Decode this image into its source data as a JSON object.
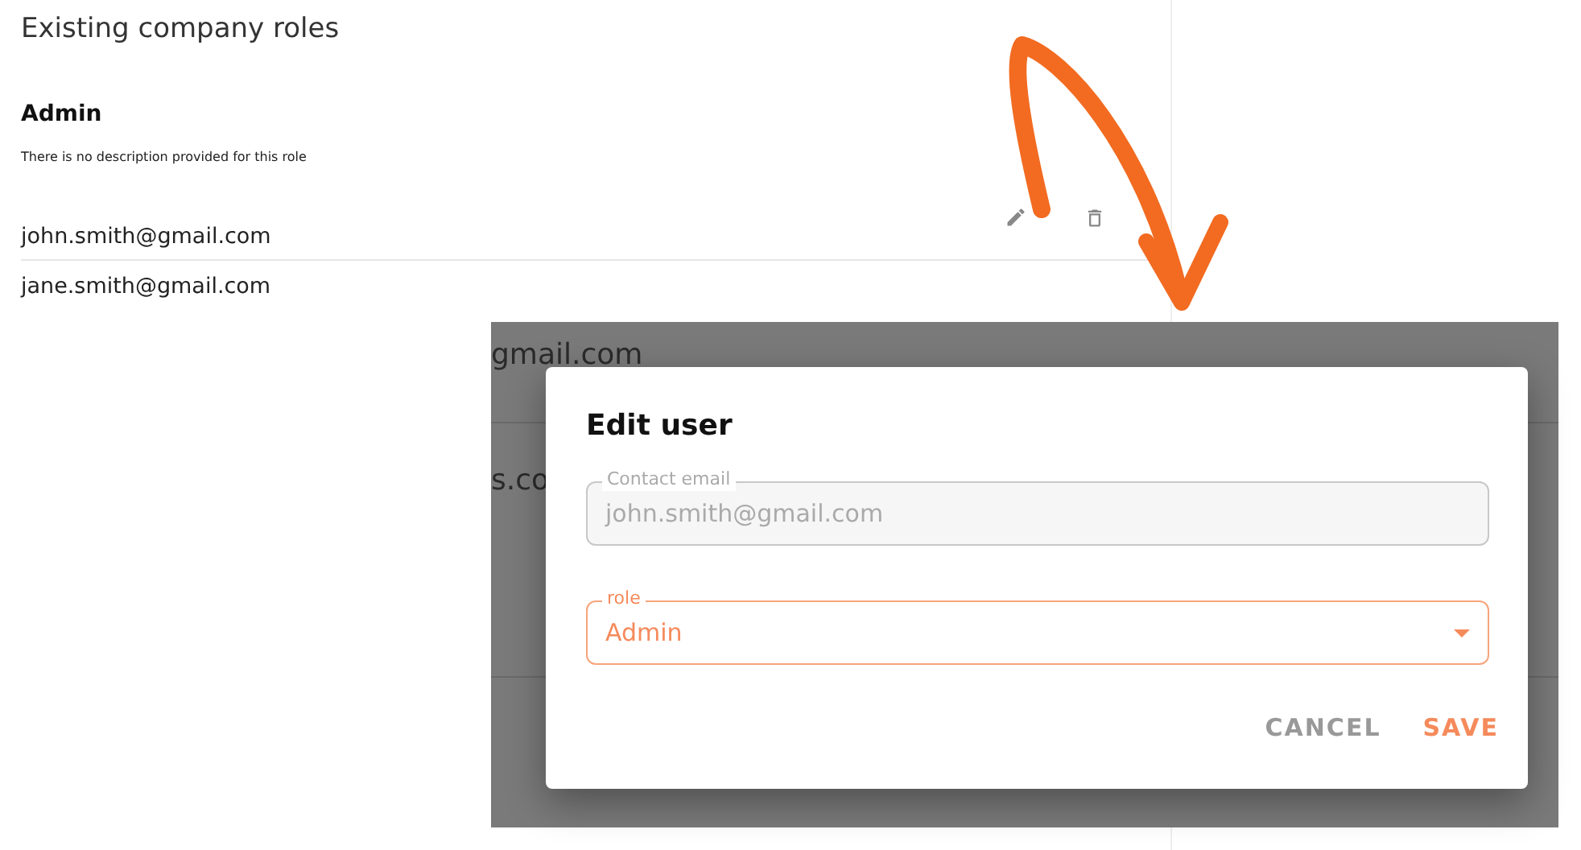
{
  "page": {
    "title": "Existing company roles",
    "role": {
      "name": "Admin",
      "description": "There is no description provided for this role"
    },
    "users": [
      {
        "email": "john.smith@gmail.com",
        "hovered": true
      },
      {
        "email": "jane.smith@gmail.com",
        "hovered": false
      }
    ]
  },
  "backdrop_texts": [
    "gmail.com",
    "s.co"
  ],
  "dialog": {
    "title": "Edit user",
    "fields": [
      {
        "kind": "text",
        "label": "Contact email",
        "value": "john.smith@gmail.com",
        "disabled": true,
        "focused": false
      },
      {
        "kind": "select",
        "label": "role",
        "value": "Admin",
        "disabled": false,
        "focused": true
      }
    ],
    "buttons": [
      {
        "label": "CANCEL",
        "primary": false
      },
      {
        "label": "SAVE",
        "primary": true
      }
    ]
  }
}
